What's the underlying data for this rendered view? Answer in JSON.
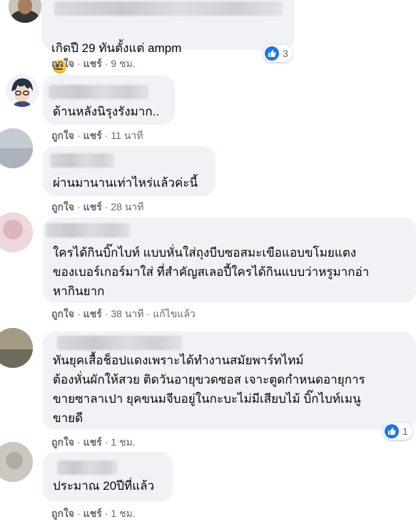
{
  "colors": {
    "bubble": "#f0f2f5",
    "action_text": "#65676b",
    "like_blue": "#1877f2"
  },
  "labels": {
    "like": "ถูกใจ",
    "reply": "แชร์",
    "edited": "แก้ไขแล้ว",
    "dot": "·"
  },
  "comments": [
    {
      "text": "เกิดปี 29 ทันตั้งแต่ ampm",
      "emoji": "neutral-face-emoji",
      "time": "9 ชม.",
      "reactions": "3"
    },
    {
      "text": "ด้านหลังนิรุงรังมาก..",
      "time": "11 นาที"
    },
    {
      "text": "ผ่านมานานเท่าไหร่แล้วค่ะนี้",
      "time": "28 นาที"
    },
    {
      "text": "ใครได้กินบิ๊กไบท์ แบบหั่นใส่ถุงบีบซอสมะเขือแอบขโมยแตง\nของเบอร์เกอร์มาใส่ ที่สำคัญสเลอปี้ใครได้กินแบบว่าหรูมากอ่า\nหากินยาก",
      "time": "38 นาที",
      "edited": true
    },
    {
      "text": "ทันยุคเสื้อช็อปแดงเพราะได้ทำงานสมัยพาร์ทไทม์\nต้องหั่นผักให้สวย ติดวันอายุขวดซอส เจาะตูดกำหนดอายุการ\nขายซาลาเปา ยุคขนมจีบอยู่ในกะบะไม่มีเสียบไม้ บิ๊กไบท์เมนู\nขายดี",
      "time": "1 ชม.",
      "reactions": "1"
    },
    {
      "text": "ประมาณ 20ปีที่แล้ว",
      "time": "1 ชม."
    }
  ]
}
